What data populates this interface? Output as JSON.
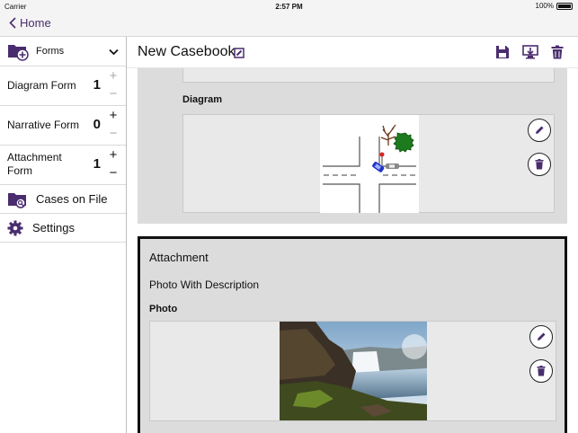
{
  "status": {
    "carrier": "Carrier",
    "time": "2:57 PM",
    "battery": "100%"
  },
  "nav": {
    "back_label": "Home"
  },
  "sidebar": {
    "forms_label": "Forms",
    "forms": [
      {
        "label": "Diagram Form",
        "count": "1",
        "plus": "+",
        "minus": "−"
      },
      {
        "label": "Narrative Form",
        "count": "0",
        "plus": "+",
        "minus": "−"
      },
      {
        "label": "Attachment Form",
        "count": "1",
        "plus": "+",
        "minus": "−"
      }
    ],
    "cases_label": "Cases on File",
    "settings_label": "Settings"
  },
  "header": {
    "title": "New Casebook"
  },
  "diagram_section": {
    "label": "Diagram"
  },
  "attachment_section": {
    "title": "Attachment",
    "description": "Photo With Description",
    "photo_label": "Photo"
  },
  "colors": {
    "accent": "#4a2d6e",
    "card_bg": "#dcdcdc"
  }
}
